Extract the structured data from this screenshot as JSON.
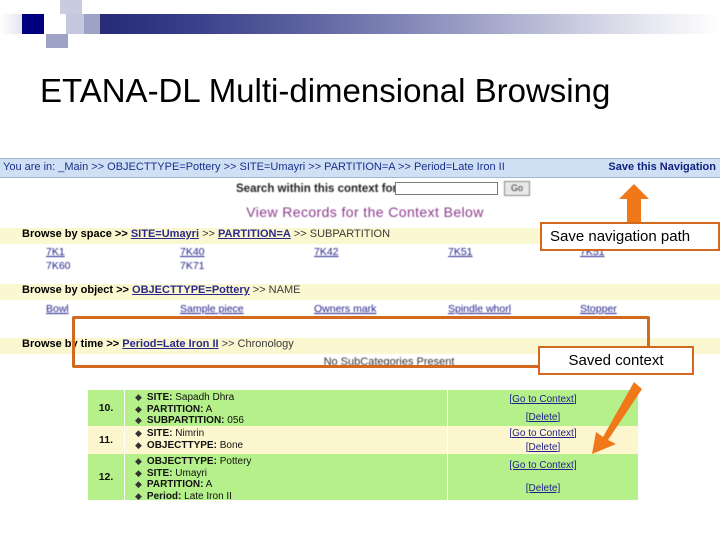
{
  "slide": {
    "title": "ETANA-DL Multi-dimensional Browsing"
  },
  "colors": {
    "accent_orange": "#d2691e",
    "header_blue": "#1b1f6b",
    "breadcrumb_bg": "#cfe0f5",
    "facet_bg": "#fbf7d0",
    "row_green": "#b5f08a",
    "row_cream": "#fdf7cf",
    "link_blue": "#22228c",
    "purple": "#8b3a8b"
  },
  "screenshot": {
    "breadcrumb": {
      "text": "You are in: _Main >> OBJECTTYPE=Pottery >> SITE=Umayri >> PARTITION=A >> Period=Late Iron II",
      "save_link": "Save this Navigation"
    },
    "search": {
      "label": "Search within this context for",
      "value": "",
      "placeholder": "",
      "go_label": "Go"
    },
    "view_records_link": "View Records for the Context Below",
    "facets": [
      {
        "lead": "Browse by space >>",
        "crumbs": [
          "SITE=Umayri",
          "PARTITION=A"
        ],
        "tail": ">> SUBPARTITION",
        "values": [
          "7K1",
          "7K40",
          "7K42",
          "7K51",
          "7K51"
        ],
        "values_row2": [
          "7K60",
          "7K71"
        ]
      },
      {
        "lead": "Browse by object >>",
        "crumbs": [
          "OBJECTTYPE=Pottery"
        ],
        "tail": ">> NAME",
        "values": [
          "Bowl",
          "Sample piece",
          "Owners mark",
          "Spindle whorl",
          "Stopper"
        ],
        "values_row2": []
      },
      {
        "lead": "Browse by time >>",
        "crumbs": [
          "Period=Late Iron II"
        ],
        "tail": ">> Chronology",
        "values": [],
        "values_row2": []
      }
    ],
    "no_subcategories": "No SubCategories Present",
    "results": {
      "action_goto": "[Go to Context]",
      "action_delete": "[Delete]",
      "rows": [
        {
          "num": "10.",
          "shade": "green",
          "fields": [
            {
              "key": "SITE:",
              "value": "Sapadh Dhra"
            },
            {
              "key": "PARTITION:",
              "value": "A"
            },
            {
              "key": "SUBPARTITION:",
              "value": "056"
            }
          ]
        },
        {
          "num": "11.",
          "shade": "cream",
          "fields": [
            {
              "key": "SITE:",
              "value": "Nimrin"
            },
            {
              "key": "OBJECTTYPE:",
              "value": "Bone"
            }
          ]
        },
        {
          "num": "12.",
          "shade": "green",
          "fields": [
            {
              "key": "OBJECTTYPE:",
              "value": "Pottery"
            },
            {
              "key": "SITE:",
              "value": "Umayri"
            },
            {
              "key": "PARTITION:",
              "value": "A"
            },
            {
              "key": "Period:",
              "value": "Late Iron II"
            }
          ]
        }
      ]
    }
  },
  "callouts": {
    "save_navigation_path": "Save navigation path",
    "saved_context": "Saved context"
  }
}
